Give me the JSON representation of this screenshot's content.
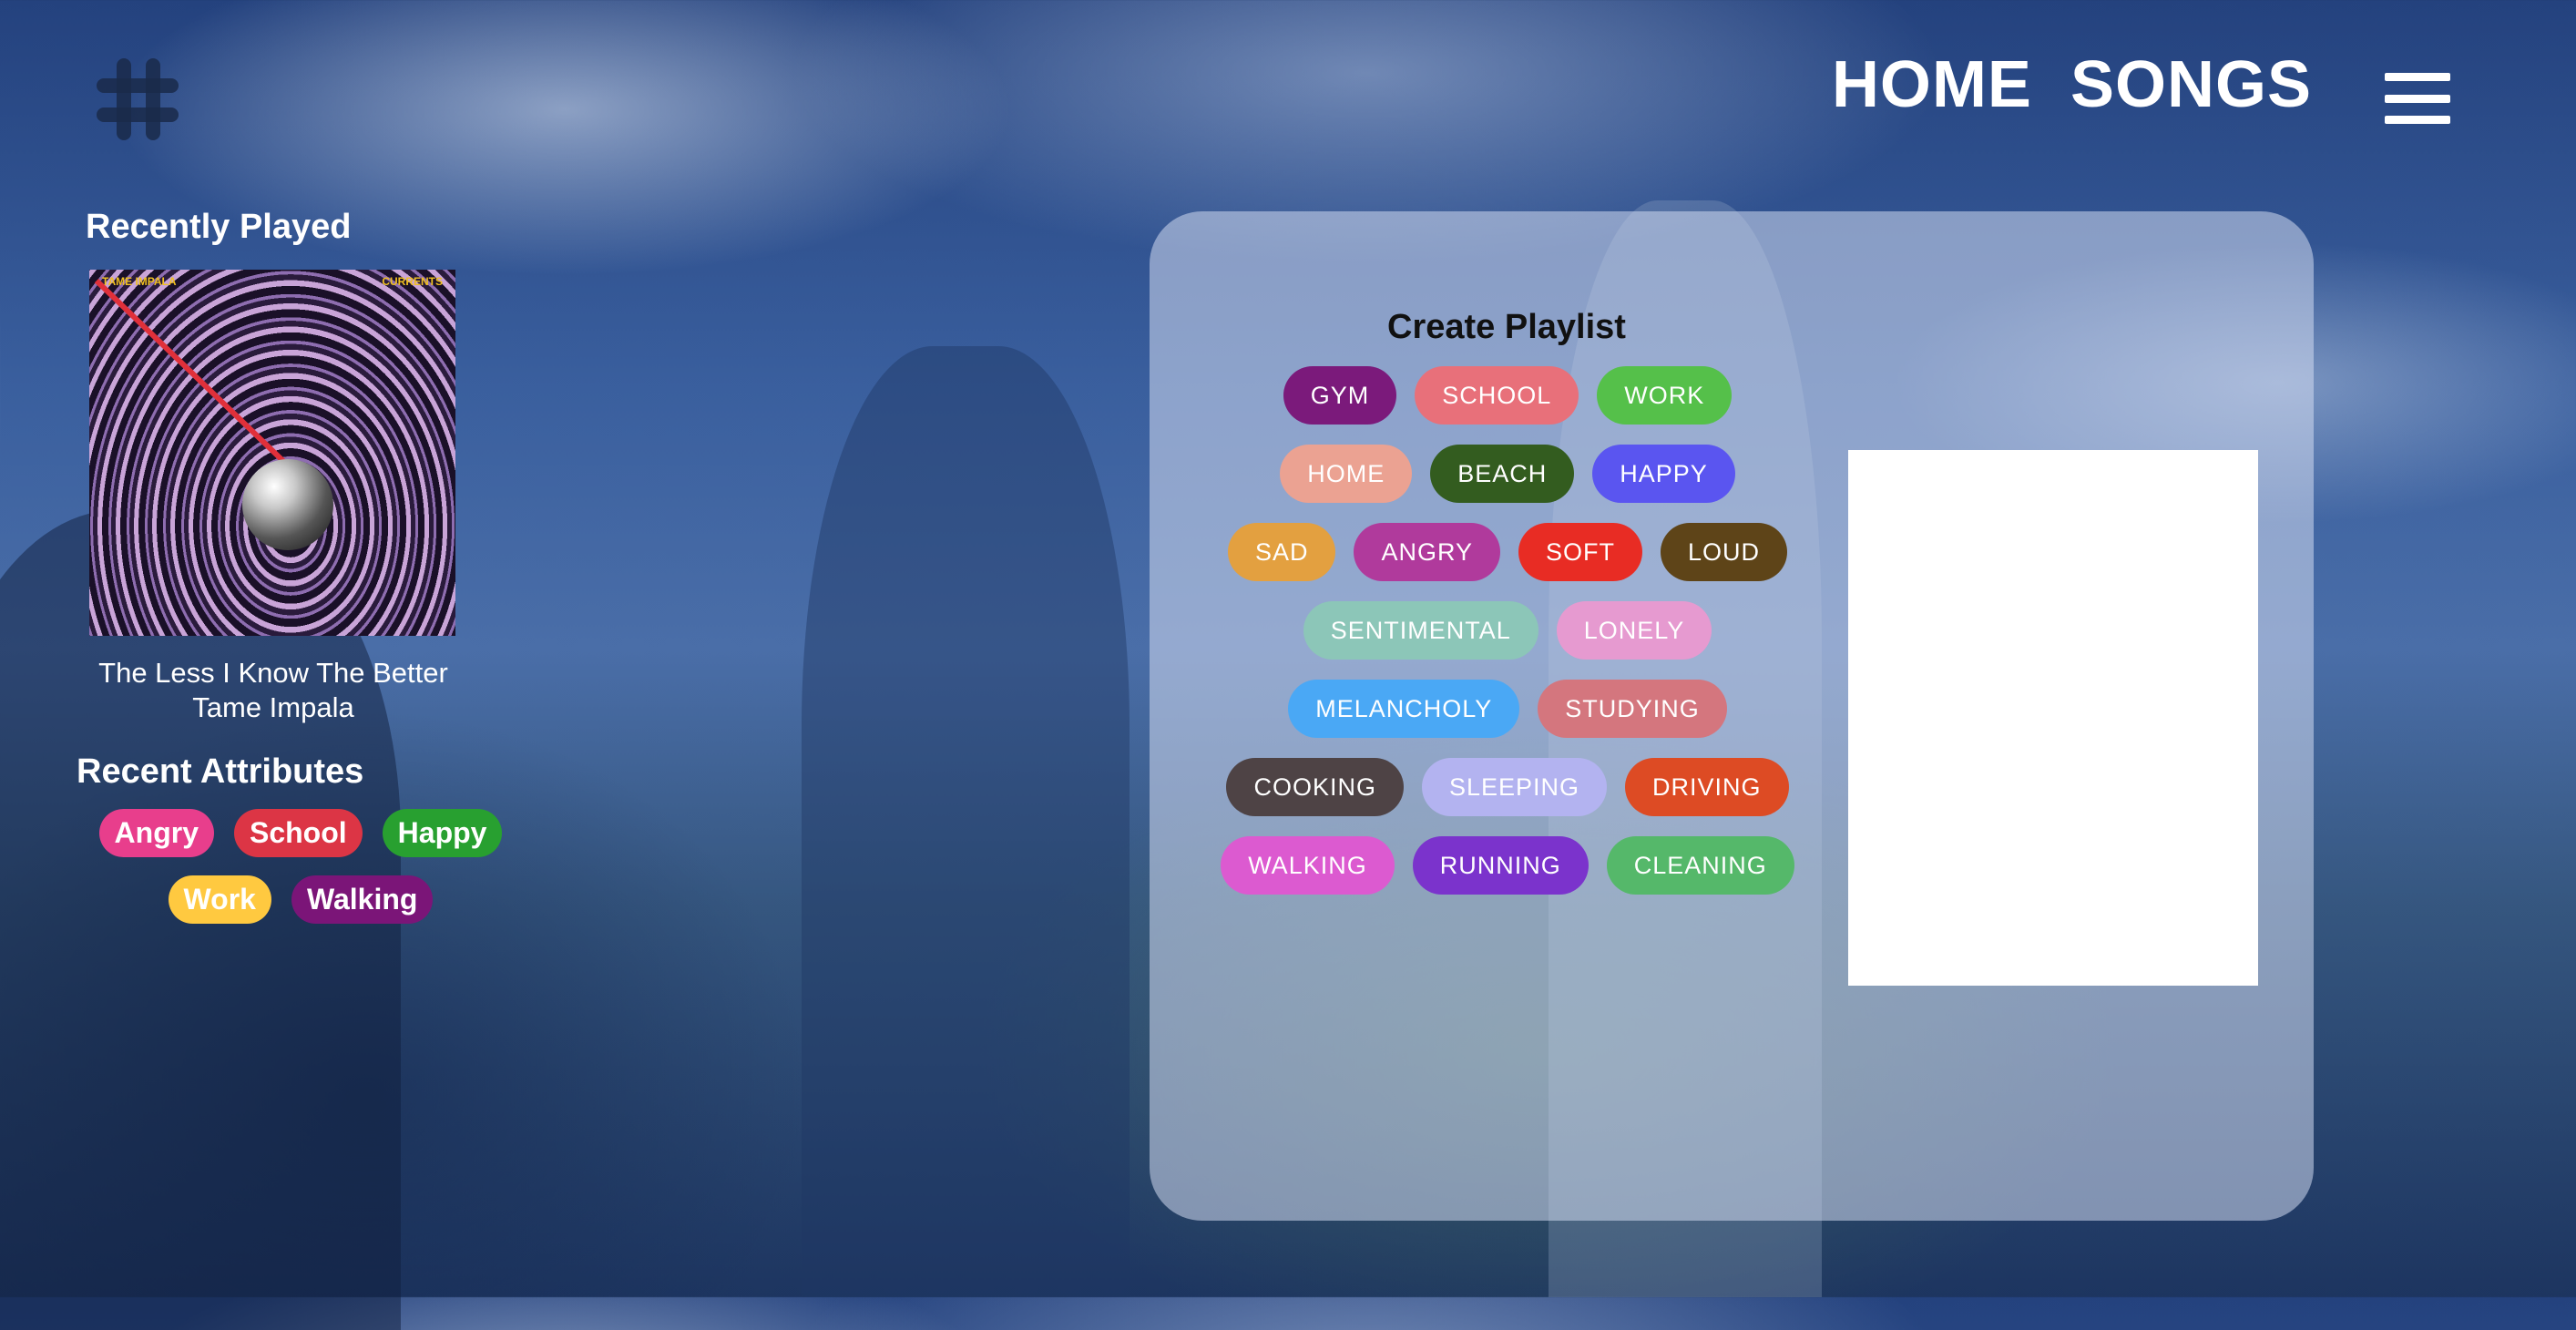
{
  "header": {
    "logo": "hash-logo-icon",
    "nav": [
      "HOME",
      "SONGS"
    ],
    "menu_icon": "hamburger-menu-icon"
  },
  "recently_played": {
    "title": "Recently Played",
    "album_cover": {
      "header_left": "TAME IMPALA",
      "header_right": "CURRENTS"
    },
    "song": "The Less I Know The Better",
    "artist": "Tame Impala"
  },
  "recent_attributes": {
    "title": "Recent Attributes",
    "items": [
      {
        "label": "Angry",
        "color": "#e83e8c"
      },
      {
        "label": "School",
        "color": "#dc3545"
      },
      {
        "label": "Happy",
        "color": "#28a030"
      },
      {
        "label": "Work",
        "color": "#ffc940"
      },
      {
        "label": "Walking",
        "color": "#7b1578"
      }
    ]
  },
  "create_playlist": {
    "title": "Create Playlist",
    "tags": [
      {
        "label": "GYM",
        "color": "#7b1a7b"
      },
      {
        "label": "SCHOOL",
        "color": "#e8707a"
      },
      {
        "label": "WORK",
        "color": "#55c04a"
      },
      {
        "label": "HOME",
        "color": "#eba292"
      },
      {
        "label": "BEACH",
        "color": "#335c1f"
      },
      {
        "label": "HAPPY",
        "color": "#5a55f0"
      },
      {
        "label": "SAD",
        "color": "#e3a040"
      },
      {
        "label": "ANGRY",
        "color": "#b03a9c"
      },
      {
        "label": "SOFT",
        "color": "#e82c24"
      },
      {
        "label": "LOUD",
        "color": "#5e4418"
      },
      {
        "label": "SENTIMENTAL",
        "color": "#8cc6b8"
      },
      {
        "label": "LONELY",
        "color": "#e69ad0"
      },
      {
        "label": "MELANCHOLY",
        "color": "#4aa8f5"
      },
      {
        "label": "STUDYING",
        "color": "#d4767e"
      },
      {
        "label": "COOKING",
        "color": "#4e4345"
      },
      {
        "label": "SLEEPING",
        "color": "#b3b3f0"
      },
      {
        "label": "DRIVING",
        "color": "#dd4b24"
      },
      {
        "label": "WALKING",
        "color": "#dc5ad0"
      },
      {
        "label": "RUNNING",
        "color": "#7b33cc"
      },
      {
        "label": "CLEANING",
        "color": "#55b86a"
      }
    ]
  }
}
